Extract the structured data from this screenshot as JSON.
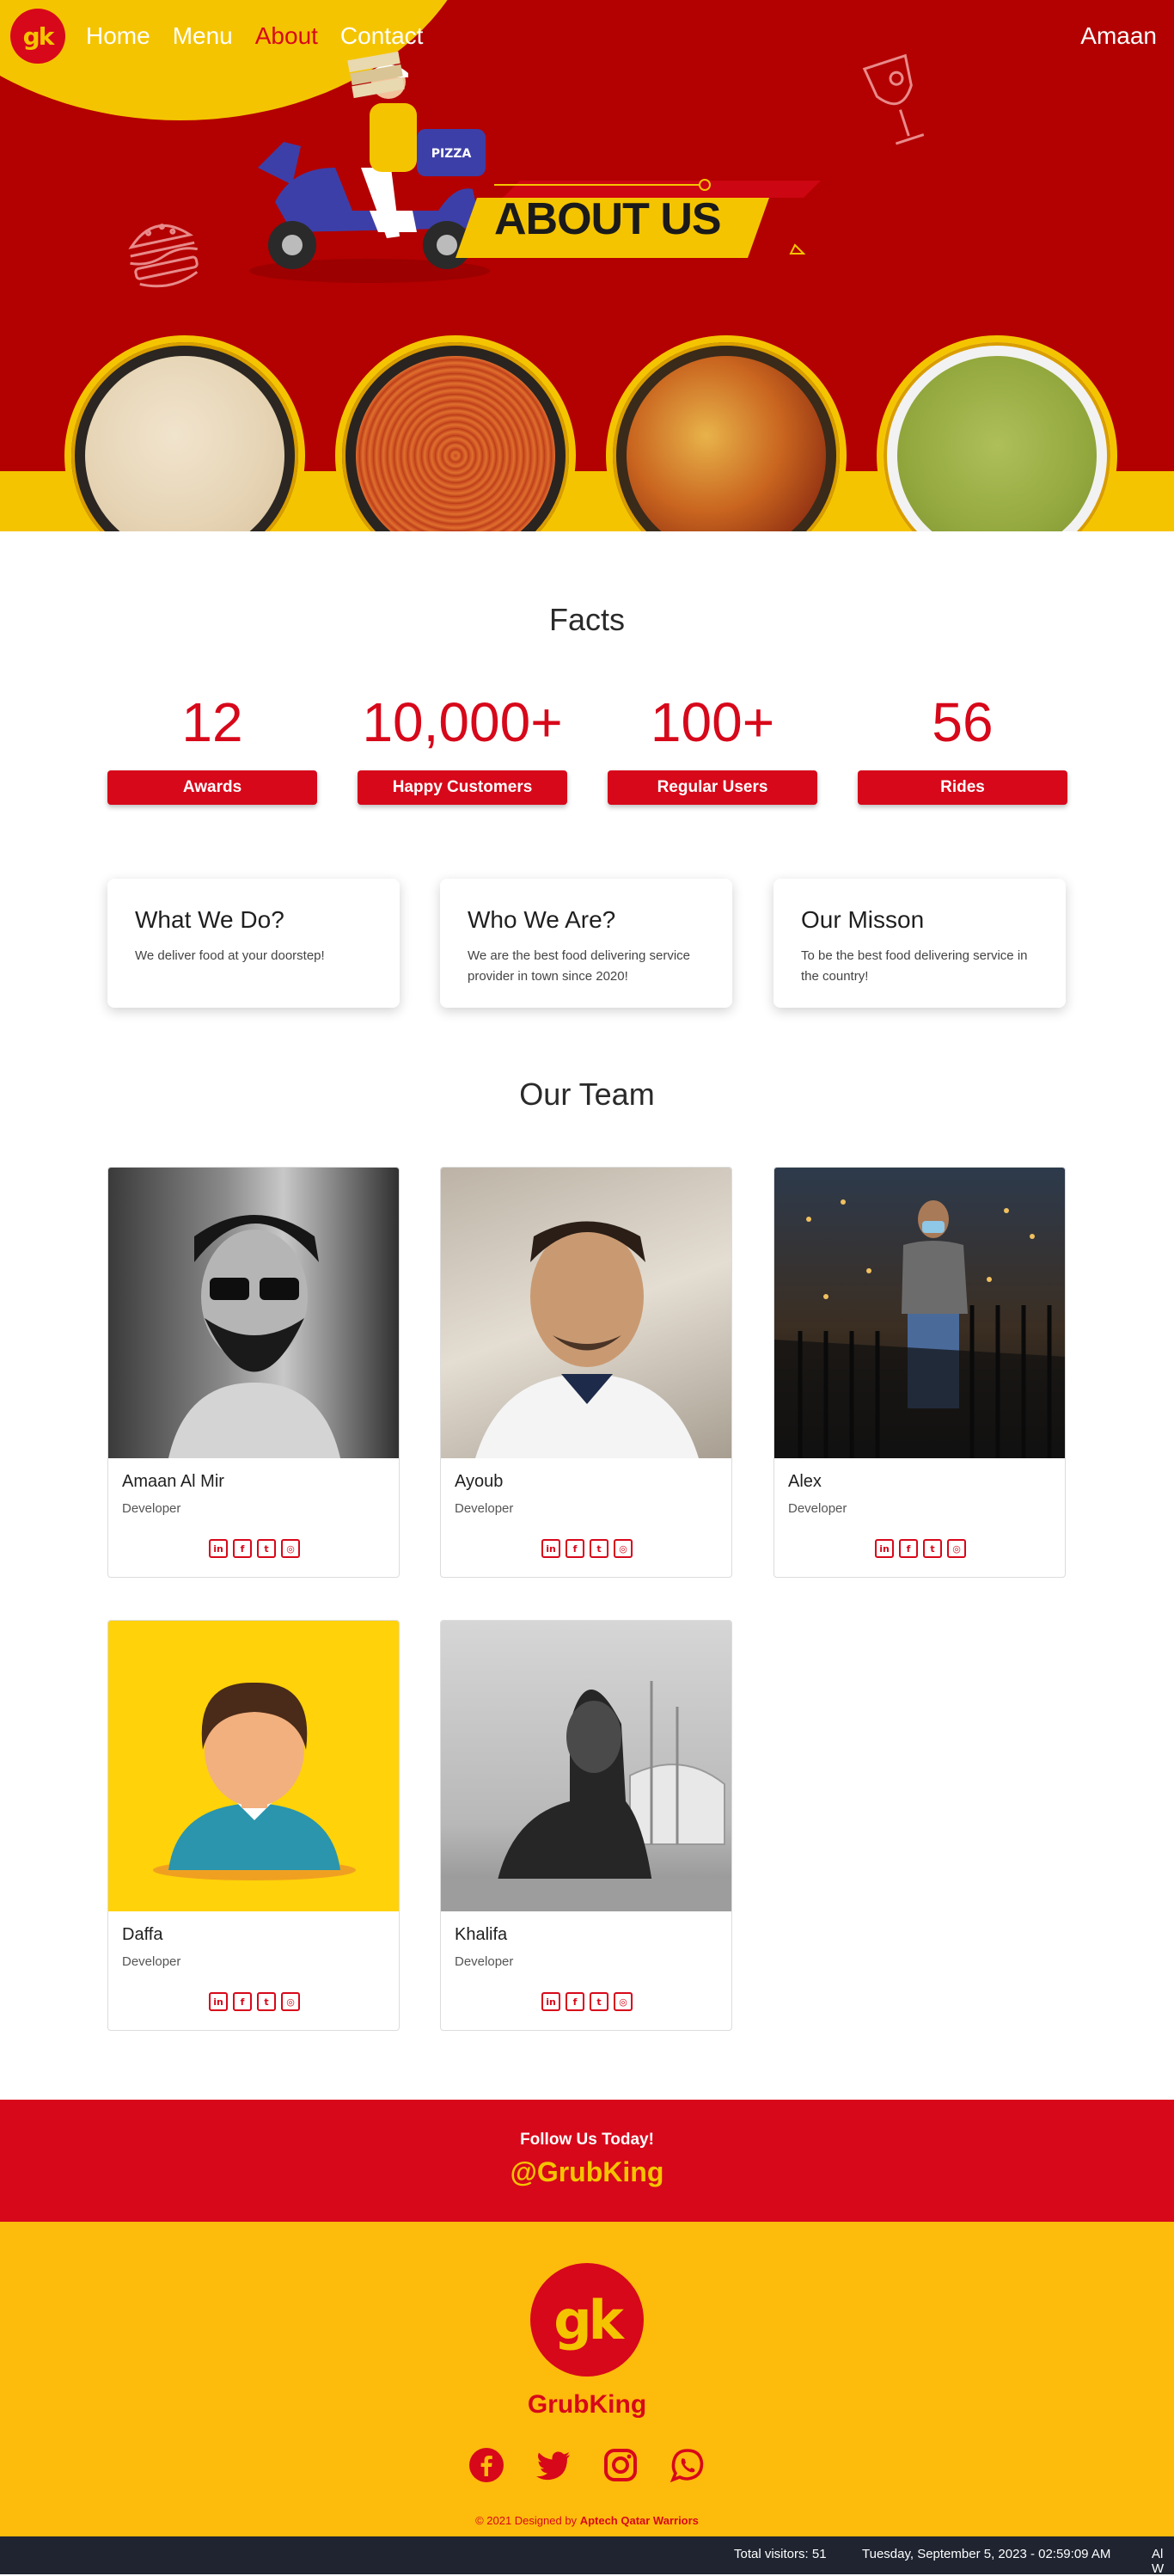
{
  "nav": {
    "logo": "gk",
    "links": [
      "Home",
      "Menu",
      "About",
      "Contact"
    ],
    "active": "About",
    "user": "Amaan"
  },
  "hero": {
    "banner_text": "ABOUT US",
    "scooter_text": "PIZZA"
  },
  "facts": {
    "title": "Facts",
    "items": [
      {
        "value": "12",
        "label": "Awards"
      },
      {
        "value": "10,000+",
        "label": "Happy Customers"
      },
      {
        "value": "100+",
        "label": "Regular Users"
      },
      {
        "value": "56",
        "label": "Rides"
      }
    ]
  },
  "info_cards": [
    {
      "title": "What We Do?",
      "text": "We deliver food at your doorstep!"
    },
    {
      "title": "Who We Are?",
      "text": "We are the best food delivering service provider in town since 2020!"
    },
    {
      "title": "Our Misson",
      "text": "To be the best food delivering service in the country!"
    }
  ],
  "team": {
    "title": "Our Team",
    "members": [
      {
        "name": "Amaan Al Mir",
        "role": "Developer"
      },
      {
        "name": "Ayoub",
        "role": "Developer"
      },
      {
        "name": "Alex",
        "role": "Developer"
      },
      {
        "name": "Daffa",
        "role": "Developer"
      },
      {
        "name": "Khalifa",
        "role": "Developer"
      }
    ],
    "social_icons": [
      "linkedin-icon",
      "facebook-icon",
      "twitter-icon",
      "instagram-icon"
    ]
  },
  "follow": {
    "heading": "Follow Us Today!",
    "handle": "@GrubKing"
  },
  "footer": {
    "logo": "gk",
    "brand": "GrubKing",
    "icons": [
      "facebook-icon",
      "twitter-icon",
      "instagram-icon",
      "whatsapp-icon"
    ],
    "copyright_prefix": "© 2021 Designed by",
    "copyright_author": "Aptech Qatar Warriors"
  },
  "status": {
    "visitors": "Total visitors: 51",
    "datetime": "Tuesday, September 5, 2023 - 02:59:09 AM",
    "trail": "Al W"
  },
  "colors": {
    "brand_red": "#d7081a",
    "hero_red": "#b30000",
    "brand_yellow": "#f5c400",
    "footer_yellow": "#fdbb0c"
  }
}
